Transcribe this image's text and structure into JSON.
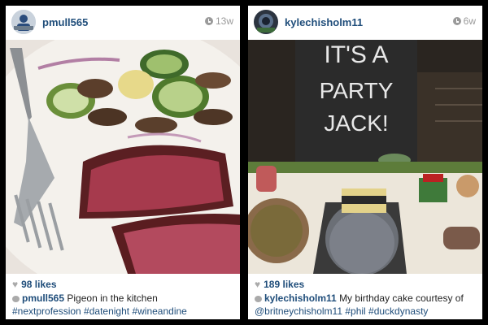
{
  "posts": [
    {
      "username": "pmull565",
      "time_ago": "13w",
      "likes": "98 likes",
      "caption_user": "pmull565",
      "caption_text": "Pigeon in the kitchen",
      "hashtags": "#nextprofession #datenight #wineandine"
    },
    {
      "username": "kylechisholm11",
      "time_ago": "6w",
      "likes": "189 likes",
      "caption_user": "kylechisholm11",
      "caption_text": "My birthday cake courtesy of",
      "hashtags": "@britneychisholm11 #phil #duckdynasty",
      "sign_text": [
        "IT'S A",
        "PARTY",
        "JACK!"
      ]
    }
  ],
  "icons": {
    "time": "clock-icon",
    "likes": "heart-icon",
    "comments": "comment-icon"
  }
}
